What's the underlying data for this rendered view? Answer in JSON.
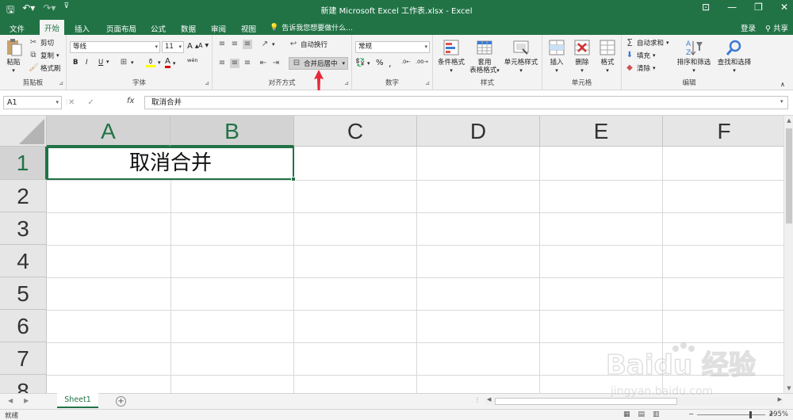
{
  "app": {
    "window_title": "新建 Microsoft Excel 工作表.xlsx - Excel",
    "brand_color": "#217346"
  },
  "tabs": [
    "文件",
    "开始",
    "插入",
    "页面布局",
    "公式",
    "数据",
    "审阅",
    "视图"
  ],
  "active_tab": "开始",
  "tell_me": "告诉我您想要做什么...",
  "account": {
    "signin": "登录",
    "share": "共享"
  },
  "ribbon": {
    "clipboard": {
      "label": "剪贴板",
      "paste": "粘贴",
      "cut": "剪切",
      "copy": "复制",
      "format_painter": "格式刷"
    },
    "font": {
      "label": "字体",
      "font_name": "等线",
      "font_size": "11",
      "bold": "B",
      "italic": "I",
      "underline": "U",
      "font_color": "A",
      "phonetic": "wén"
    },
    "alignment": {
      "label": "对齐方式",
      "wrap_text": "自动换行",
      "merge_center": "合并后居中"
    },
    "number": {
      "label": "数字",
      "format": "常规",
      "percent": "%",
      "comma": ","
    },
    "styles": {
      "label": "样式",
      "conditional": "条件格式",
      "table_format_1": "套用",
      "table_format_2": "表格格式",
      "cell_styles": "单元格样式"
    },
    "cells": {
      "label": "单元格",
      "insert": "插入",
      "delete": "删除",
      "format": "格式"
    },
    "editing": {
      "label": "编辑",
      "autosum": "自动求和",
      "fill": "填充",
      "clear": "清除",
      "sort_filter": "排序和筛选",
      "find_select": "查找和选择"
    }
  },
  "formula_bar": {
    "name_box": "A1",
    "fx": "fx",
    "content": "取消合并"
  },
  "columns": [
    "A",
    "B",
    "C",
    "D",
    "E",
    "F"
  ],
  "rows": [
    "1",
    "2",
    "3",
    "4",
    "5",
    "6",
    "7",
    "8"
  ],
  "cells": {
    "A1": "取消合并"
  },
  "sheets": [
    "Sheet1"
  ],
  "status": {
    "ready": "就绪",
    "zoom": "295%"
  },
  "watermark": {
    "line1": "Baidu 经验",
    "line2": "jingyan.baidu.com"
  }
}
